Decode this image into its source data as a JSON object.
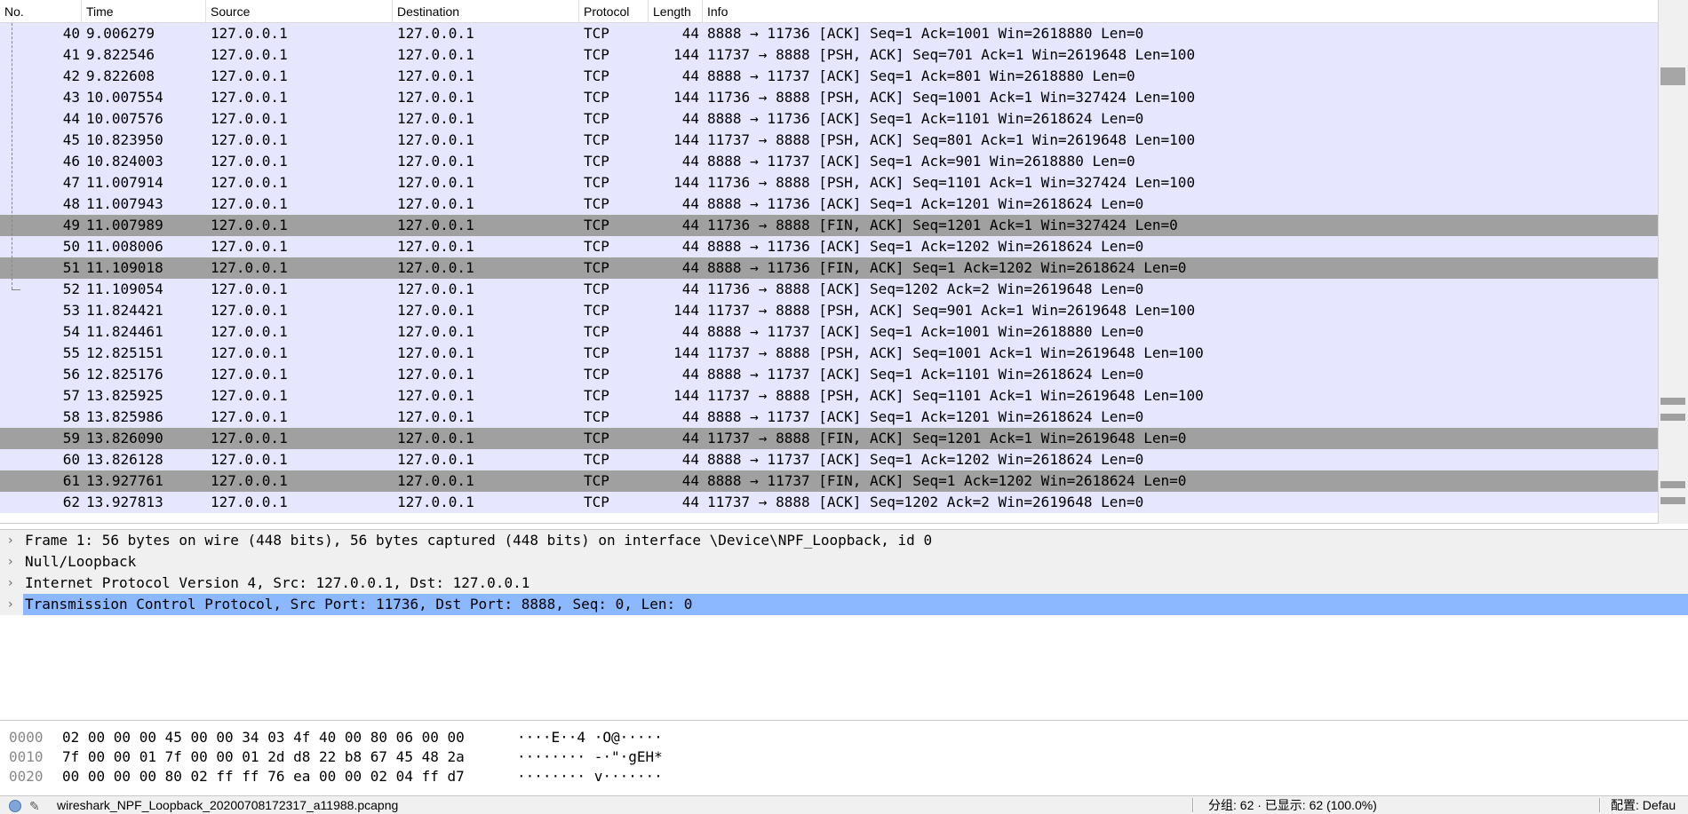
{
  "columns": [
    "No.",
    "Time",
    "Source",
    "Destination",
    "Protocol",
    "Length",
    "Info"
  ],
  "packets": [
    {
      "no": "40",
      "time": "9.006279",
      "src": "127.0.0.1",
      "dst": "127.0.0.1",
      "proto": "TCP",
      "len": "44",
      "info": "8888 → 11736 [ACK] Seq=1 Ack=1001 Win=2618880 Len=0",
      "marked": false
    },
    {
      "no": "41",
      "time": "9.822546",
      "src": "127.0.0.1",
      "dst": "127.0.0.1",
      "proto": "TCP",
      "len": "144",
      "info": "11737 → 8888 [PSH, ACK] Seq=701 Ack=1 Win=2619648 Len=100",
      "marked": false
    },
    {
      "no": "42",
      "time": "9.822608",
      "src": "127.0.0.1",
      "dst": "127.0.0.1",
      "proto": "TCP",
      "len": "44",
      "info": "8888 → 11737 [ACK] Seq=1 Ack=801 Win=2618880 Len=0",
      "marked": false
    },
    {
      "no": "43",
      "time": "10.007554",
      "src": "127.0.0.1",
      "dst": "127.0.0.1",
      "proto": "TCP",
      "len": "144",
      "info": "11736 → 8888 [PSH, ACK] Seq=1001 Ack=1 Win=327424 Len=100",
      "marked": false
    },
    {
      "no": "44",
      "time": "10.007576",
      "src": "127.0.0.1",
      "dst": "127.0.0.1",
      "proto": "TCP",
      "len": "44",
      "info": "8888 → 11736 [ACK] Seq=1 Ack=1101 Win=2618624 Len=0",
      "marked": false
    },
    {
      "no": "45",
      "time": "10.823950",
      "src": "127.0.0.1",
      "dst": "127.0.0.1",
      "proto": "TCP",
      "len": "144",
      "info": "11737 → 8888 [PSH, ACK] Seq=801 Ack=1 Win=2619648 Len=100",
      "marked": false
    },
    {
      "no": "46",
      "time": "10.824003",
      "src": "127.0.0.1",
      "dst": "127.0.0.1",
      "proto": "TCP",
      "len": "44",
      "info": "8888 → 11737 [ACK] Seq=1 Ack=901 Win=2618880 Len=0",
      "marked": false
    },
    {
      "no": "47",
      "time": "11.007914",
      "src": "127.0.0.1",
      "dst": "127.0.0.1",
      "proto": "TCP",
      "len": "144",
      "info": "11736 → 8888 [PSH, ACK] Seq=1101 Ack=1 Win=327424 Len=100",
      "marked": false
    },
    {
      "no": "48",
      "time": "11.007943",
      "src": "127.0.0.1",
      "dst": "127.0.0.1",
      "proto": "TCP",
      "len": "44",
      "info": "8888 → 11736 [ACK] Seq=1 Ack=1201 Win=2618624 Len=0",
      "marked": false
    },
    {
      "no": "49",
      "time": "11.007989",
      "src": "127.0.0.1",
      "dst": "127.0.0.1",
      "proto": "TCP",
      "len": "44",
      "info": "11736 → 8888 [FIN, ACK] Seq=1201 Ack=1 Win=327424 Len=0",
      "marked": true
    },
    {
      "no": "50",
      "time": "11.008006",
      "src": "127.0.0.1",
      "dst": "127.0.0.1",
      "proto": "TCP",
      "len": "44",
      "info": "8888 → 11736 [ACK] Seq=1 Ack=1202 Win=2618624 Len=0",
      "marked": false
    },
    {
      "no": "51",
      "time": "11.109018",
      "src": "127.0.0.1",
      "dst": "127.0.0.1",
      "proto": "TCP",
      "len": "44",
      "info": "8888 → 11736 [FIN, ACK] Seq=1 Ack=1202 Win=2618624 Len=0",
      "marked": true
    },
    {
      "no": "52",
      "time": "11.109054",
      "src": "127.0.0.1",
      "dst": "127.0.0.1",
      "proto": "TCP",
      "len": "44",
      "info": "11736 → 8888 [ACK] Seq=1202 Ack=2 Win=2619648 Len=0",
      "marked": false
    },
    {
      "no": "53",
      "time": "11.824421",
      "src": "127.0.0.1",
      "dst": "127.0.0.1",
      "proto": "TCP",
      "len": "144",
      "info": "11737 → 8888 [PSH, ACK] Seq=901 Ack=1 Win=2619648 Len=100",
      "marked": false
    },
    {
      "no": "54",
      "time": "11.824461",
      "src": "127.0.0.1",
      "dst": "127.0.0.1",
      "proto": "TCP",
      "len": "44",
      "info": "8888 → 11737 [ACK] Seq=1 Ack=1001 Win=2618880 Len=0",
      "marked": false
    },
    {
      "no": "55",
      "time": "12.825151",
      "src": "127.0.0.1",
      "dst": "127.0.0.1",
      "proto": "TCP",
      "len": "144",
      "info": "11737 → 8888 [PSH, ACK] Seq=1001 Ack=1 Win=2619648 Len=100",
      "marked": false
    },
    {
      "no": "56",
      "time": "12.825176",
      "src": "127.0.0.1",
      "dst": "127.0.0.1",
      "proto": "TCP",
      "len": "44",
      "info": "8888 → 11737 [ACK] Seq=1 Ack=1101 Win=2618624 Len=0",
      "marked": false
    },
    {
      "no": "57",
      "time": "13.825925",
      "src": "127.0.0.1",
      "dst": "127.0.0.1",
      "proto": "TCP",
      "len": "144",
      "info": "11737 → 8888 [PSH, ACK] Seq=1101 Ack=1 Win=2619648 Len=100",
      "marked": false
    },
    {
      "no": "58",
      "time": "13.825986",
      "src": "127.0.0.1",
      "dst": "127.0.0.1",
      "proto": "TCP",
      "len": "44",
      "info": "8888 → 11737 [ACK] Seq=1 Ack=1201 Win=2618624 Len=0",
      "marked": false
    },
    {
      "no": "59",
      "time": "13.826090",
      "src": "127.0.0.1",
      "dst": "127.0.0.1",
      "proto": "TCP",
      "len": "44",
      "info": "11737 → 8888 [FIN, ACK] Seq=1201 Ack=1 Win=2619648 Len=0",
      "marked": true
    },
    {
      "no": "60",
      "time": "13.826128",
      "src": "127.0.0.1",
      "dst": "127.0.0.1",
      "proto": "TCP",
      "len": "44",
      "info": "8888 → 11737 [ACK] Seq=1 Ack=1202 Win=2618624 Len=0",
      "marked": false
    },
    {
      "no": "61",
      "time": "13.927761",
      "src": "127.0.0.1",
      "dst": "127.0.0.1",
      "proto": "TCP",
      "len": "44",
      "info": "8888 → 11737 [FIN, ACK] Seq=1 Ack=1202 Win=2618624 Len=0",
      "marked": true
    },
    {
      "no": "62",
      "time": "13.927813",
      "src": "127.0.0.1",
      "dst": "127.0.0.1",
      "proto": "TCP",
      "len": "44",
      "info": "11737 → 8888 [ACK] Seq=1202 Ack=2 Win=2619648 Len=0",
      "marked": false
    }
  ],
  "details": [
    {
      "text": "Frame 1: 56 bytes on wire (448 bits), 56 bytes captured (448 bits) on interface \\Device\\NPF_Loopback, id 0",
      "selected": false
    },
    {
      "text": "Null/Loopback",
      "selected": false
    },
    {
      "text": "Internet Protocol Version 4, Src: 127.0.0.1, Dst: 127.0.0.1",
      "selected": false
    },
    {
      "text": "Transmission Control Protocol, Src Port: 11736, Dst Port: 8888, Seq: 0, Len: 0",
      "selected": true
    }
  ],
  "detail_chevron": "›",
  "hex": [
    {
      "offset": "0000",
      "bytes": "02 00 00 00 45 00 00 34  03 4f 40 00 80 06 00 00",
      "ascii": "····E··4 ·O@·····"
    },
    {
      "offset": "0010",
      "bytes": "7f 00 00 01 7f 00 00 01  2d d8 22 b8 67 45 48 2a",
      "ascii": "········ -·\"·gEH*"
    },
    {
      "offset": "0020",
      "bytes": "00 00 00 00 80 02 ff ff  76 ea 00 00 02 04 ff d7",
      "ascii": "········ v·······"
    }
  ],
  "status": {
    "file": "wireshark_NPF_Loopback_20200708172317_a11988.pcapng",
    "packets": "分组: 62 · 已显示: 62 (100.0%)",
    "profile": "配置: Defau"
  },
  "colors": {
    "row_bg": "#e7e6ff",
    "marked_row_bg": "#a0a0a0",
    "selected_detail_bg": "#8cb8ff"
  }
}
